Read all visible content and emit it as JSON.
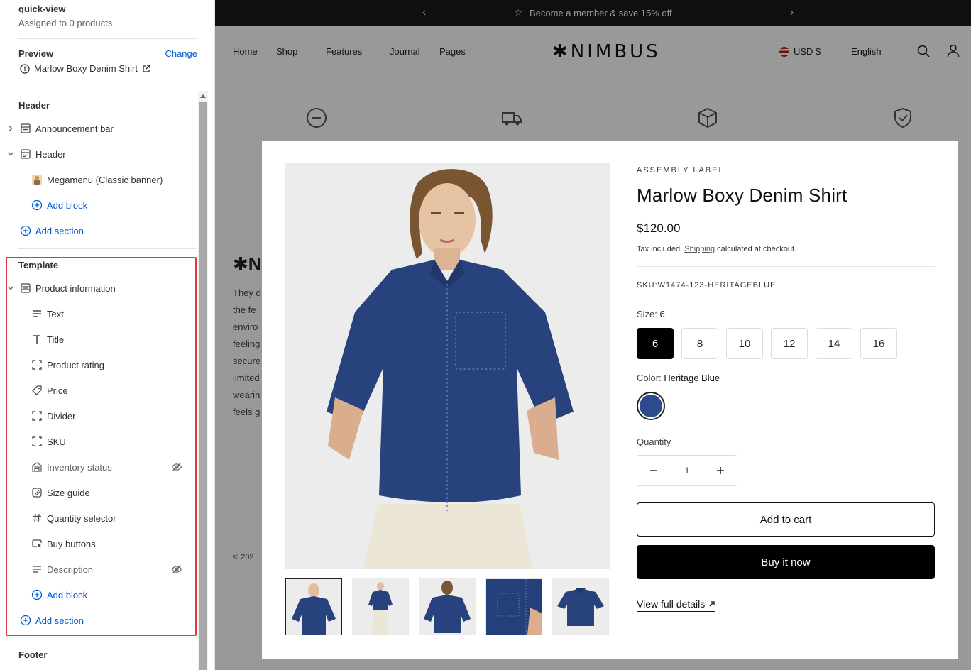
{
  "sidebar": {
    "template_name": "quick-view",
    "assigned": "Assigned to 0 products",
    "preview_label": "Preview",
    "change_label": "Change",
    "preview_product": "Marlow Boxy Denim Shirt",
    "header_section": "Header",
    "header_items": {
      "announcement_bar": "Announcement bar",
      "header": "Header",
      "megamenu": "Megamenu (Classic banner)",
      "add_block": "Add block",
      "add_section": "Add section"
    },
    "template_section": "Template",
    "template_items": {
      "product_information": "Product information",
      "text": "Text",
      "title": "Title",
      "product_rating": "Product rating",
      "price": "Price",
      "divider": "Divider",
      "sku": "SKU",
      "inventory_status": "Inventory status",
      "size_guide": "Size guide",
      "quantity_selector": "Quantity selector",
      "buy_buttons": "Buy buttons",
      "description": "Description",
      "add_block": "Add block",
      "add_section": "Add section"
    },
    "footer_section": "Footer",
    "highlight_color": "#e0383e",
    "link_color": "#005bd3"
  },
  "store": {
    "announcement": "Become a member & save 15% off",
    "nav": [
      "Home",
      "Shop",
      "Features",
      "Journal",
      "Pages"
    ],
    "brand": "✱NIMBUS",
    "currency": "USD $",
    "language": "English",
    "bg_text_fragments": [
      "✱N",
      "They d",
      "the fe",
      "enviro",
      "feeling",
      "secure",
      "limited",
      "wearin",
      "feels g",
      "© 202"
    ]
  },
  "quick_view": {
    "vendor": "ASSEMBLY LABEL",
    "title": "Marlow Boxy Denim Shirt",
    "price": "$120.00",
    "tax_prefix": "Tax included.",
    "tax_link": "Shipping",
    "tax_suffix": "calculated at checkout.",
    "sku": "SKU:W1474-123-HERITAGEBLUE",
    "size_label": "Size:",
    "size_value": "6",
    "sizes": [
      "6",
      "8",
      "10",
      "12",
      "14",
      "16"
    ],
    "color_label": "Color:",
    "color_value": "Heritage Blue",
    "color_hex": "#2c4a8c",
    "quantity_label": "Quantity",
    "quantity": "1",
    "add_to_cart": "Add to cart",
    "buy_now": "Buy it now",
    "view_details": "View full details"
  }
}
